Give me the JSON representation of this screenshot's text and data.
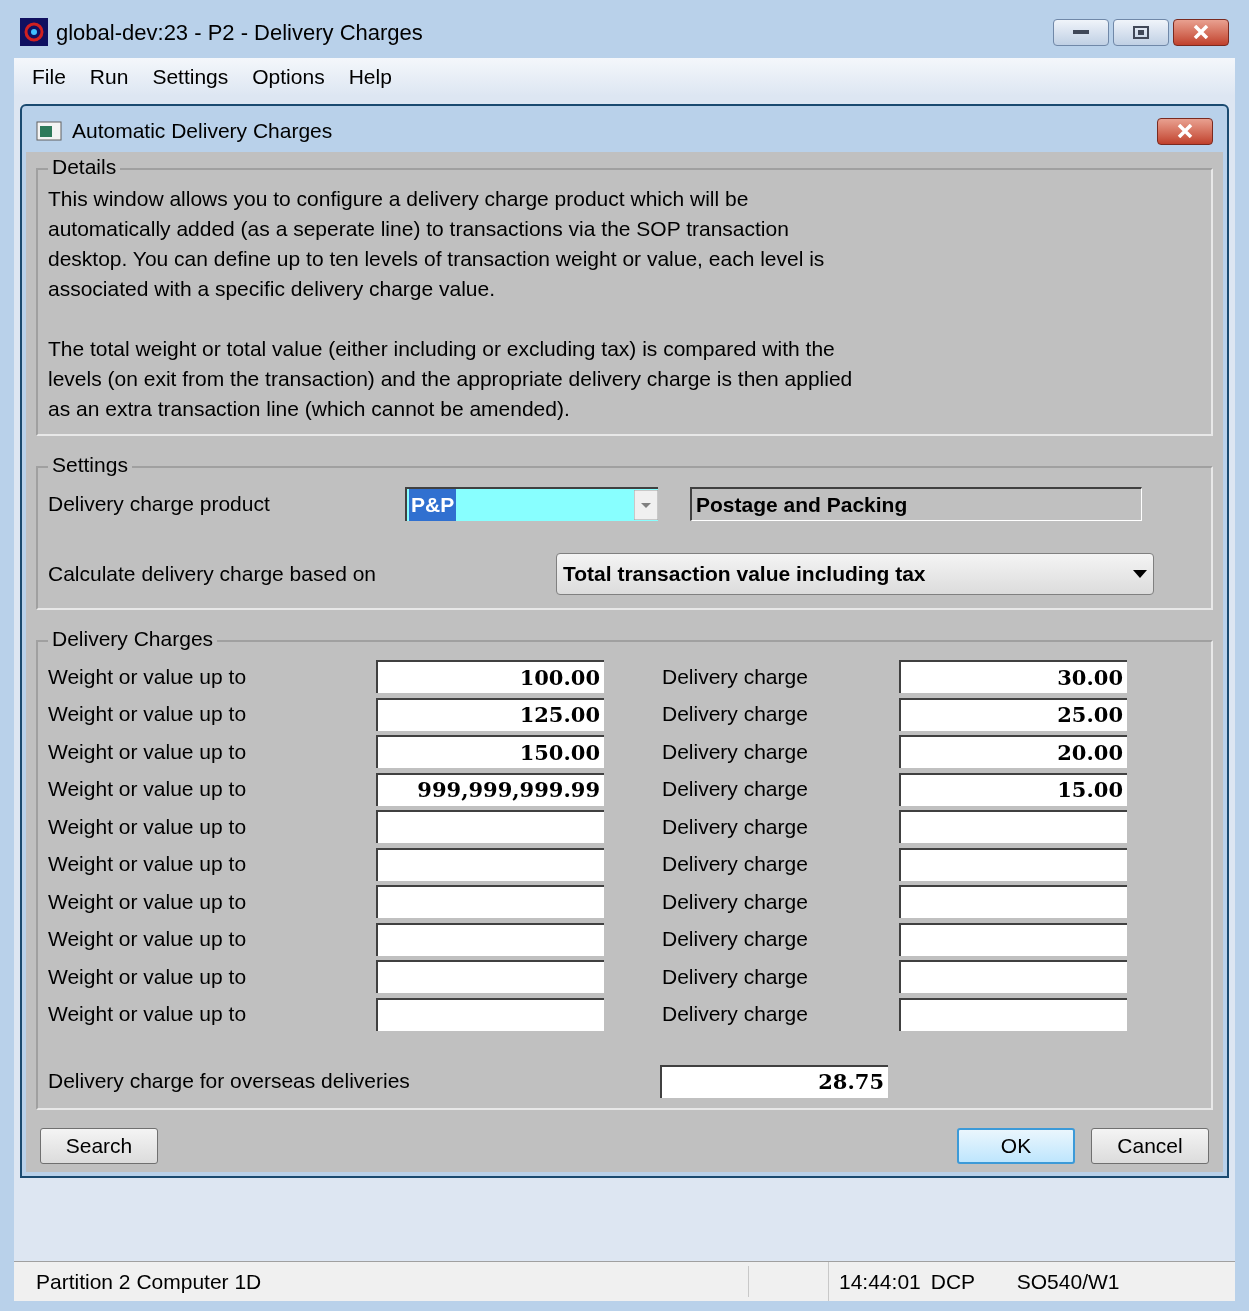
{
  "window": {
    "title": "global-dev:23 - P2 - Delivery Charges"
  },
  "menu": [
    "File",
    "Run",
    "Settings",
    "Options",
    "Help"
  ],
  "dialog": {
    "title": "Automatic Delivery Charges"
  },
  "details": {
    "title": "Details",
    "paragraphs": [
      "This window allows you to configure a delivery charge product which will be automatically added (as a seperate line) to transactions via the SOP transaction desktop.  You can define up to ten levels of transaction weight or value, each level is associated with a specific delivery charge value.",
      "The total weight or total value (either including or excluding tax) is compared with the levels (on exit from the transaction) and the appropriate delivery charge is then applied as an extra transaction line (which cannot be amended)."
    ]
  },
  "settings": {
    "title": "Settings",
    "product_label": "Delivery charge product",
    "product_value": "P&P",
    "product_selected": true,
    "product_description": "Postage and Packing",
    "basis_label": "Calculate delivery charge based on",
    "basis_value": "Total transaction value including tax"
  },
  "charges": {
    "title": "Delivery Charges",
    "rows": [
      {
        "label": "Weight or value up to",
        "value": "100.00",
        "charge_label": "Delivery charge",
        "charge": "30.00"
      },
      {
        "label": "Weight or value up to",
        "value": "125.00",
        "charge_label": "Delivery charge",
        "charge": "25.00"
      },
      {
        "label": "Weight or value up to",
        "value": "150.00",
        "charge_label": "Delivery charge",
        "charge": "20.00"
      },
      {
        "label": "Weight or value up to",
        "value": "999,999,999.99",
        "charge_label": "Delivery charge",
        "charge": "15.00"
      },
      {
        "label": "Weight or value up to",
        "charge_label": "Delivery charge"
      },
      {
        "label": "Weight or value up to",
        "charge_label": "Delivery charge"
      },
      {
        "label": "Weight or value up to",
        "charge_label": "Delivery charge"
      },
      {
        "label": "Weight or value up to",
        "charge_label": "Delivery charge"
      },
      {
        "label": "Weight or value up to",
        "charge_label": "Delivery charge"
      },
      {
        "label": "Weight or value up to",
        "charge_label": "Delivery charge"
      }
    ],
    "overseas_label": "Delivery charge for overseas deliveries",
    "overseas_value": "28.75"
  },
  "buttons": {
    "left": "Search",
    "ok": "OK",
    "cancel": "Cancel"
  },
  "status_bar": {
    "partition": "Partition 2 Computer 1D",
    "time": "14:44:01",
    "user": "DCP",
    "program": "SO540/W1"
  }
}
